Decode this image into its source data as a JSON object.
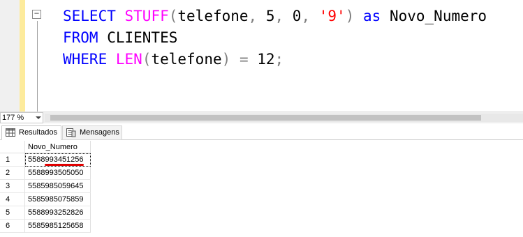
{
  "editor": {
    "fold_symbol": "−",
    "lines": [
      [
        {
          "t": "SELECT",
          "c": "kw"
        },
        {
          "t": " ",
          "c": "tx"
        },
        {
          "t": "STUFF",
          "c": "fn"
        },
        {
          "t": "(",
          "c": "op"
        },
        {
          "t": "telefone",
          "c": "tx"
        },
        {
          "t": ",",
          "c": "op"
        },
        {
          "t": " 5",
          "c": "tx"
        },
        {
          "t": ",",
          "c": "op"
        },
        {
          "t": " 0",
          "c": "tx"
        },
        {
          "t": ",",
          "c": "op"
        },
        {
          "t": " ",
          "c": "tx"
        },
        {
          "t": "'9'",
          "c": "str"
        },
        {
          "t": ")",
          "c": "op"
        },
        {
          "t": " ",
          "c": "tx"
        },
        {
          "t": "as",
          "c": "kw"
        },
        {
          "t": " Novo_Numero",
          "c": "tx"
        }
      ],
      [
        {
          "t": "FROM",
          "c": "kw"
        },
        {
          "t": " CLIENTES",
          "c": "tx"
        }
      ],
      [
        {
          "t": "WHERE",
          "c": "kw"
        },
        {
          "t": " ",
          "c": "tx"
        },
        {
          "t": "LEN",
          "c": "fn"
        },
        {
          "t": "(",
          "c": "op"
        },
        {
          "t": "telefone",
          "c": "tx"
        },
        {
          "t": ")",
          "c": "op"
        },
        {
          "t": " ",
          "c": "tx"
        },
        {
          "t": "=",
          "c": "op"
        },
        {
          "t": " 12",
          "c": "tx"
        },
        {
          "t": ";",
          "c": "op"
        }
      ]
    ]
  },
  "zoom": {
    "value": "177 %"
  },
  "tabs": {
    "results_label": "Resultados",
    "messages_label": "Mensagens",
    "results_icon": "grid-icon",
    "messages_icon": "messages-icon"
  },
  "grid": {
    "column_header": "Novo_Numero",
    "rows": [
      {
        "num": "1",
        "value": "5588993451256"
      },
      {
        "num": "2",
        "value": "5588993505050"
      },
      {
        "num": "3",
        "value": "5585985059645"
      },
      {
        "num": "4",
        "value": "5585985075859"
      },
      {
        "num": "5",
        "value": "5588993252826"
      },
      {
        "num": "6",
        "value": "5585985125658"
      }
    ]
  },
  "colors": {
    "keyword": "#0000ff",
    "function": "#ff00ff",
    "string": "#ff0000",
    "operator": "#808080",
    "change_bar": "#fdeb9c",
    "annotation_underline": "#e00000"
  }
}
